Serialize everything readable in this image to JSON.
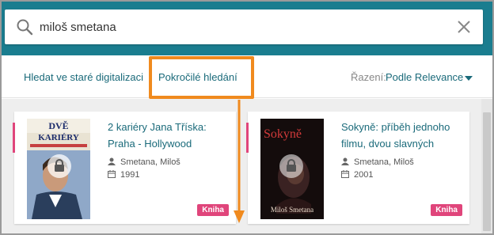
{
  "search": {
    "value": "miloš smetana",
    "icon": "search-icon",
    "clear_icon": "close-icon"
  },
  "toolbar": {
    "old_digitization_link": "Hledat ve staré digitalizaci",
    "advanced_search_link": "Pokročilé hledání",
    "sort_label": "Řazení:",
    "sort_value": "Podle Relevance"
  },
  "colors": {
    "header": "#1a7d8f",
    "link": "#1a6a7a",
    "badge": "#e0457b",
    "highlight": "#f08a1e"
  },
  "results": [
    {
      "title": "2 kariéry Jana Tříska: Praha - Hollywood",
      "author": "Smetana, Miloš",
      "year": "1991",
      "type": "Kniha",
      "cover_title": "DVĚ KARIÉRY"
    },
    {
      "title": "Sokyně: příběh jednoho filmu, dvou slavných",
      "author": "Smetana, Miloš",
      "year": "2001",
      "type": "Kniha",
      "cover_title": "Sokyně",
      "cover_author": "Miloš Smetana"
    }
  ]
}
